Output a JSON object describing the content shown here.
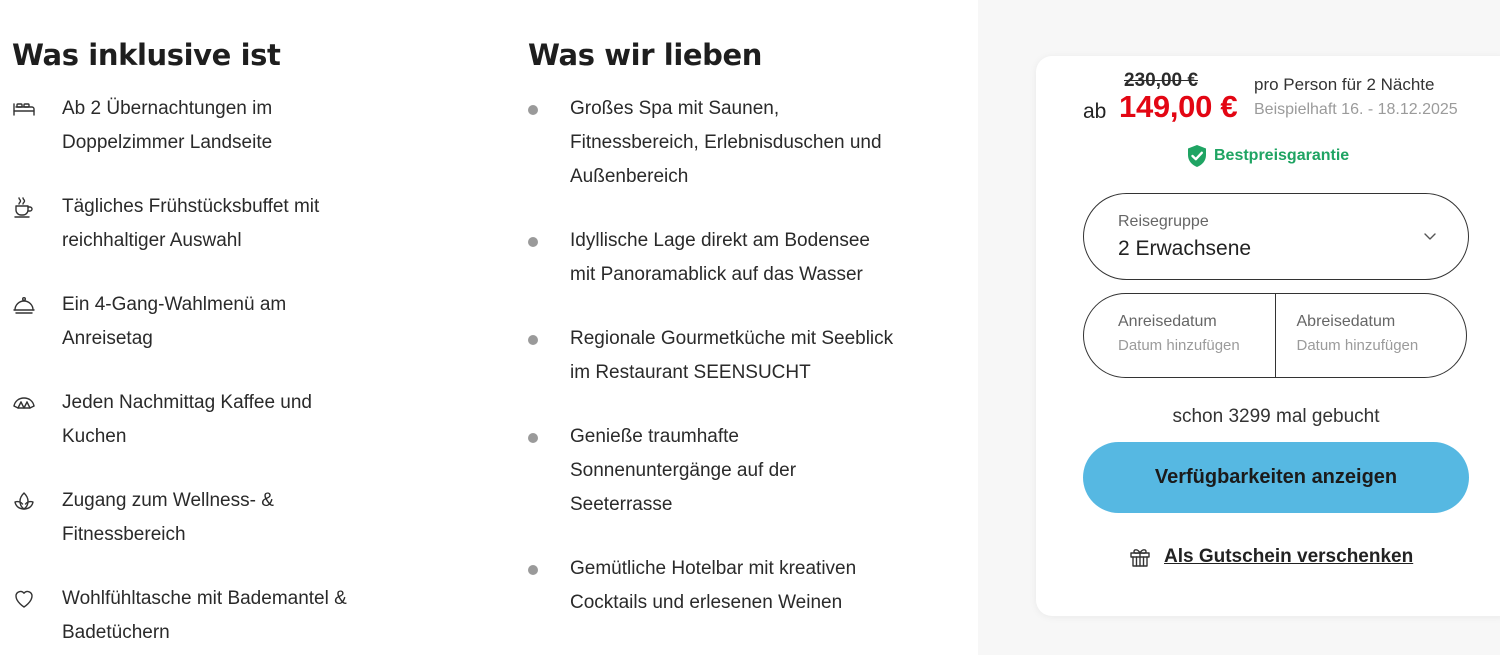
{
  "included": {
    "title": "Was inklusive ist",
    "items": [
      {
        "icon": "bed-icon",
        "lines": [
          "Ab 2 Übernachtungen im",
          "Doppelzimmer Landseite"
        ]
      },
      {
        "icon": "coffee-cup-icon",
        "lines": [
          "Tägliches Frühstücksbuffet mit",
          "reichhaltiger Auswahl"
        ]
      },
      {
        "icon": "cloche-icon",
        "lines": [
          "Ein 4-Gang-Wahlmenü am",
          "Anreisetag"
        ]
      },
      {
        "icon": "croissant-icon",
        "lines": [
          "Jeden Nachmittag Kaffee und",
          "Kuchen"
        ]
      },
      {
        "icon": "lotus-icon",
        "lines": [
          "Zugang zum Wellness- &",
          "Fitnessbereich"
        ]
      },
      {
        "icon": "heart-icon",
        "lines": [
          "Wohlfühltasche mit Bademantel &",
          "Badetüchern"
        ]
      }
    ]
  },
  "loved": {
    "title": "Was wir lieben",
    "items": [
      {
        "lines": [
          "Großes Spa mit Saunen,",
          "Fitnessbereich, Erlebnisduschen und",
          "Außenbereich"
        ]
      },
      {
        "lines": [
          "Idyllische Lage direkt am Bodensee",
          "mit Panoramablick auf das Wasser"
        ]
      },
      {
        "lines": [
          "Regionale Gourmetküche mit Seeblick",
          "im Restaurant SEENSUCHT"
        ]
      },
      {
        "lines": [
          "Genieße traumhafte",
          "Sonnenuntergänge auf der",
          "Seeterrasse"
        ]
      },
      {
        "lines": [
          "Gemütliche Hotelbar mit kreativen",
          "Cocktails und erlesenen Weinen"
        ]
      }
    ]
  },
  "booking": {
    "old_price": "230,00 €",
    "price_prefix": "ab",
    "price": "149,00 €",
    "price_note": "pro Person für 2 Nächte",
    "example_dates": "Beispielhaft 16. - 18.12.2025",
    "guarantee": "Bestpreisgarantie",
    "group_label": "Reisegruppe",
    "group_value": "2 Erwachsene",
    "arrival_label": "Anreisedatum",
    "arrival_placeholder": "Datum hinzufügen",
    "departure_label": "Abreisedatum",
    "departure_placeholder": "Datum hinzufügen",
    "booked_count": "schon 3299 mal gebucht",
    "cta": "Verfügbarkeiten anzeigen",
    "voucher": "Als Gutschein verschenken"
  },
  "colors": {
    "price_red": "#e30613",
    "guarantee_green": "#1fa463",
    "cta_blue": "#56b8e2",
    "panel_bg": "#f7f7f7"
  }
}
